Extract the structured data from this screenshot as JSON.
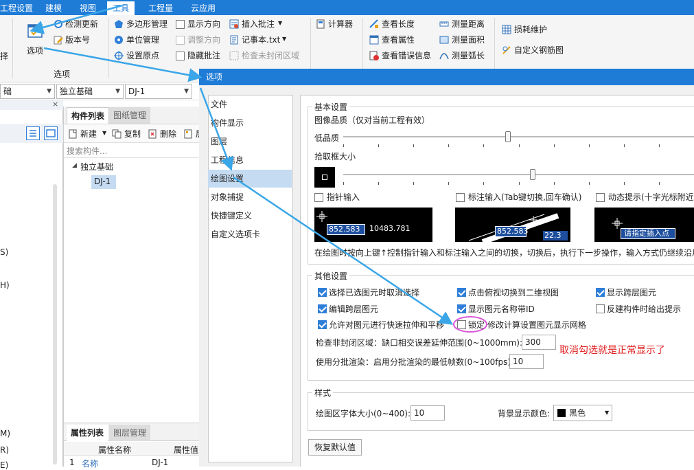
{
  "menubar": {
    "items": [
      "工程设置",
      "建模",
      "视图",
      "工具",
      "工程量",
      "云应用"
    ],
    "active_index": 3
  },
  "ribbon": {
    "options_big_label": "选项",
    "group_label": "选项",
    "left_cut_label": "择",
    "col1": [
      "检测更新",
      "版本号"
    ],
    "col2": [
      "多边形管理",
      "单位管理",
      "设置原点"
    ],
    "col3": [
      "显示方向",
      "调整方向",
      "隐藏批注"
    ],
    "col4": [
      "插入批注",
      "记事本.txt",
      "检查未封闭区域"
    ],
    "calculator": "计算器",
    "col6": [
      "查看长度",
      "查看属性",
      "查看错误信息"
    ],
    "col7": [
      "测量距离",
      "测量面积",
      "测量弧长"
    ],
    "col8": [
      "损耗维护",
      "自定义钢筋图"
    ]
  },
  "combos": {
    "c1": "础",
    "c2": "独立基础",
    "c3": "DJ-1"
  },
  "leftpane": {
    "side_labels": [
      "S)",
      "H)",
      "M)",
      "R)",
      "E)"
    ]
  },
  "midpane": {
    "tab_components": "构件列表",
    "tab_drawings": "图纸管理",
    "new_label": "新建",
    "copy_label": "复制",
    "delete_label": "删除",
    "more_label": "层",
    "search_placeholder": "搜索构件...",
    "tree_root": "独立基础",
    "tree_child": "DJ-1",
    "prop_tab": "属性列表",
    "layer_tab": "图层管理",
    "prop_col_name": "属性名称",
    "prop_col_value": "属性值",
    "prop_row_index": "1",
    "prop_row_name": "名称",
    "prop_row_value": "DJ-1"
  },
  "dialog": {
    "title": "选项",
    "nav": [
      "文件",
      "构件显示",
      "图层",
      "工程信息",
      "绘图设置",
      "对象捕捉",
      "快捷键定义",
      "自定义选项卡"
    ],
    "selected_nav_index": 4,
    "basic": {
      "group_label": "基本设置",
      "quality_label": "图像品质（仅对当前工程有效）",
      "low_quality": "低品质",
      "pick_box_label": "拾取框大小",
      "quality_level": 0.47,
      "pickbox_level": 0.54
    },
    "inputs": {
      "pointer_input": "指针输入",
      "dim_input": "标注输入(Tab键切换,回车确认)",
      "dyn_tip": "动态提示(十字光标附近显",
      "preview1_a": "852.583",
      "preview1_b": "10483.781",
      "preview2_a": "852.583",
      "preview2_b": "22.3",
      "preview3_a": "请指定插入点"
    },
    "hint_text": "在绘图时按向上键↑控制指针输入和标注输入之间的切换，切换后，执行下一步操作，输入方式仍继续沿用",
    "other": {
      "group_label": "其他设置",
      "options": [
        {
          "label": "选择已选图元时取消选择",
          "checked": true
        },
        {
          "label": "点击俯视切换到二维视图",
          "checked": true
        },
        {
          "label": "显示跨层图元",
          "checked": true
        },
        {
          "label": "编辑跨层图元",
          "checked": true
        },
        {
          "label": "显示图元名称带ID",
          "checked": true
        },
        {
          "label": "反建构件时给出提示",
          "checked": false
        },
        {
          "label": "允许对图元进行快速拉伸和平移",
          "checked": true
        },
        {
          "label": "锁定",
          "checked": false
        },
        {
          "label": "修改计算设置图元显示网格",
          "checked": null
        }
      ],
      "unclosed_label": "检查非封闭区域：缺口相交误差延伸范围(0~1000mm):",
      "unclosed_value": "300",
      "batch_label": "使用分批渲染：启用分批渲染的最低帧数(0~100fps):",
      "batch_value": "10"
    },
    "style": {
      "group_label": "样式",
      "font_size_label": "绘图区字体大小(0~400):",
      "font_size_value": "10",
      "bg_color_label": "背景显示颜色:",
      "bg_color_value": "黑色"
    },
    "restore_button": "恢复默认值"
  },
  "annotation": {
    "text": "取消勾选就是正常显示了",
    "color": "#e02020"
  },
  "colors": {
    "accent": "#1e7bd6",
    "arrow": "#3aa6e8",
    "circle": "#d957d9"
  }
}
